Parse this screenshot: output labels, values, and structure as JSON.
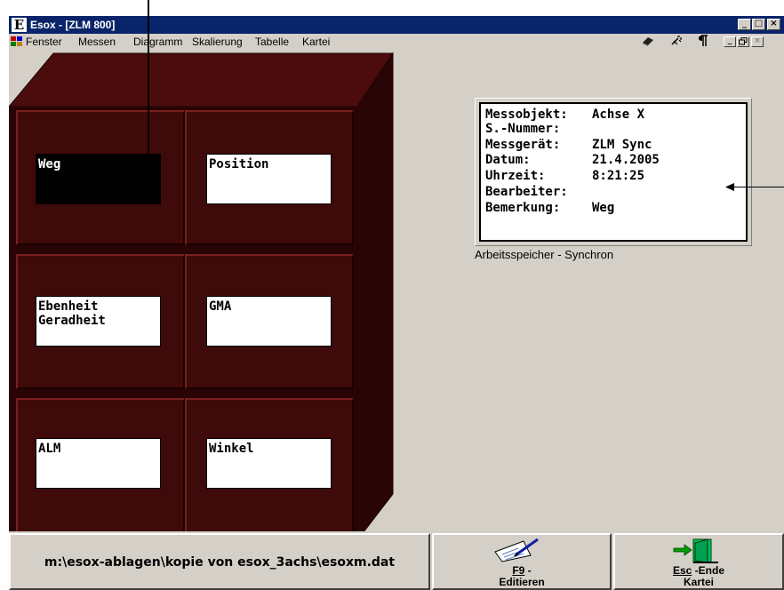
{
  "window": {
    "title": "Esox - [ZLM 800]",
    "app_icon_letter": "E",
    "minimize_glyph": "_",
    "maximize_glyph": "□",
    "close_glyph": "×",
    "restore_glyph": "🗗"
  },
  "menu": {
    "items": [
      "Fenster",
      "Messen",
      "Diagramm",
      "Skalierung",
      "Tabelle",
      "Kartei"
    ],
    "toolbar_icons": [
      "eraser-icon",
      "magic-wand-icon",
      "paragraph-icon"
    ]
  },
  "cabinet": {
    "drawers": [
      {
        "label": "Weg",
        "selected": true
      },
      {
        "label": "Position",
        "selected": false
      },
      {
        "label": "Ebenheit\nGeradheit",
        "selected": false
      },
      {
        "label": "GMA",
        "selected": false
      },
      {
        "label": "ALM",
        "selected": false
      },
      {
        "label": "Winkel",
        "selected": false
      }
    ]
  },
  "info": {
    "rows": [
      {
        "key": "Messobjekt:",
        "value": "Achse X"
      },
      {
        "key": "S.-Nummer:",
        "value": ""
      },
      {
        "key": "Messgerät:",
        "value": "ZLM Sync"
      },
      {
        "key": "Datum:",
        "value": "21.4.2005"
      },
      {
        "key": "Uhrzeit:",
        "value": "8:21:25"
      },
      {
        "key": "Bearbeiter:",
        "value": ""
      },
      {
        "key": "Bemerkung:",
        "value": "Weg"
      }
    ],
    "memory_status": "Arbeitsspeicher - Synchron"
  },
  "bottom": {
    "file_path": "m:\\esox-ablagen\\kopie von esox_3achs\\esoxm.dat",
    "edit_button": {
      "key": "F9",
      "sep": " -",
      "label": "Editieren"
    },
    "exit_button": {
      "key": "Esc",
      "sep": " -Ende",
      "label": "Kartei"
    }
  },
  "colors": {
    "titlebar": "#0a246a",
    "window_bg": "#d4d0c8",
    "cabinet": "#3f0a0a",
    "cabinet_top": "#4a0c0c",
    "cabinet_side": "#2a0505"
  }
}
